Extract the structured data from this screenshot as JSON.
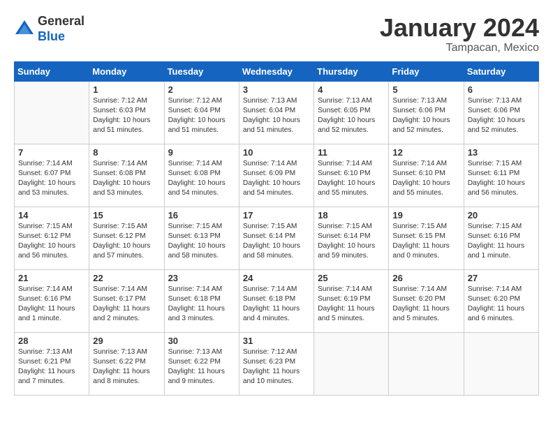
{
  "header": {
    "logo_general": "General",
    "logo_blue": "Blue",
    "month_title": "January 2024",
    "location": "Tampacan, Mexico"
  },
  "columns": [
    "Sunday",
    "Monday",
    "Tuesday",
    "Wednesday",
    "Thursday",
    "Friday",
    "Saturday"
  ],
  "weeks": [
    [
      {
        "day": "",
        "info": ""
      },
      {
        "day": "1",
        "info": "Sunrise: 7:12 AM\nSunset: 6:03 PM\nDaylight: 10 hours\nand 51 minutes."
      },
      {
        "day": "2",
        "info": "Sunrise: 7:12 AM\nSunset: 6:04 PM\nDaylight: 10 hours\nand 51 minutes."
      },
      {
        "day": "3",
        "info": "Sunrise: 7:13 AM\nSunset: 6:04 PM\nDaylight: 10 hours\nand 51 minutes."
      },
      {
        "day": "4",
        "info": "Sunrise: 7:13 AM\nSunset: 6:05 PM\nDaylight: 10 hours\nand 52 minutes."
      },
      {
        "day": "5",
        "info": "Sunrise: 7:13 AM\nSunset: 6:06 PM\nDaylight: 10 hours\nand 52 minutes."
      },
      {
        "day": "6",
        "info": "Sunrise: 7:13 AM\nSunset: 6:06 PM\nDaylight: 10 hours\nand 52 minutes."
      }
    ],
    [
      {
        "day": "7",
        "info": "Sunrise: 7:14 AM\nSunset: 6:07 PM\nDaylight: 10 hours\nand 53 minutes."
      },
      {
        "day": "8",
        "info": "Sunrise: 7:14 AM\nSunset: 6:08 PM\nDaylight: 10 hours\nand 53 minutes."
      },
      {
        "day": "9",
        "info": "Sunrise: 7:14 AM\nSunset: 6:08 PM\nDaylight: 10 hours\nand 54 minutes."
      },
      {
        "day": "10",
        "info": "Sunrise: 7:14 AM\nSunset: 6:09 PM\nDaylight: 10 hours\nand 54 minutes."
      },
      {
        "day": "11",
        "info": "Sunrise: 7:14 AM\nSunset: 6:10 PM\nDaylight: 10 hours\nand 55 minutes."
      },
      {
        "day": "12",
        "info": "Sunrise: 7:14 AM\nSunset: 6:10 PM\nDaylight: 10 hours\nand 55 minutes."
      },
      {
        "day": "13",
        "info": "Sunrise: 7:15 AM\nSunset: 6:11 PM\nDaylight: 10 hours\nand 56 minutes."
      }
    ],
    [
      {
        "day": "14",
        "info": "Sunrise: 7:15 AM\nSunset: 6:12 PM\nDaylight: 10 hours\nand 56 minutes."
      },
      {
        "day": "15",
        "info": "Sunrise: 7:15 AM\nSunset: 6:12 PM\nDaylight: 10 hours\nand 57 minutes."
      },
      {
        "day": "16",
        "info": "Sunrise: 7:15 AM\nSunset: 6:13 PM\nDaylight: 10 hours\nand 58 minutes."
      },
      {
        "day": "17",
        "info": "Sunrise: 7:15 AM\nSunset: 6:14 PM\nDaylight: 10 hours\nand 58 minutes."
      },
      {
        "day": "18",
        "info": "Sunrise: 7:15 AM\nSunset: 6:14 PM\nDaylight: 10 hours\nand 59 minutes."
      },
      {
        "day": "19",
        "info": "Sunrise: 7:15 AM\nSunset: 6:15 PM\nDaylight: 11 hours\nand 0 minutes."
      },
      {
        "day": "20",
        "info": "Sunrise: 7:15 AM\nSunset: 6:16 PM\nDaylight: 11 hours\nand 1 minute."
      }
    ],
    [
      {
        "day": "21",
        "info": "Sunrise: 7:14 AM\nSunset: 6:16 PM\nDaylight: 11 hours\nand 1 minute."
      },
      {
        "day": "22",
        "info": "Sunrise: 7:14 AM\nSunset: 6:17 PM\nDaylight: 11 hours\nand 2 minutes."
      },
      {
        "day": "23",
        "info": "Sunrise: 7:14 AM\nSunset: 6:18 PM\nDaylight: 11 hours\nand 3 minutes."
      },
      {
        "day": "24",
        "info": "Sunrise: 7:14 AM\nSunset: 6:18 PM\nDaylight: 11 hours\nand 4 minutes."
      },
      {
        "day": "25",
        "info": "Sunrise: 7:14 AM\nSunset: 6:19 PM\nDaylight: 11 hours\nand 5 minutes."
      },
      {
        "day": "26",
        "info": "Sunrise: 7:14 AM\nSunset: 6:20 PM\nDaylight: 11 hours\nand 5 minutes."
      },
      {
        "day": "27",
        "info": "Sunrise: 7:14 AM\nSunset: 6:20 PM\nDaylight: 11 hours\nand 6 minutes."
      }
    ],
    [
      {
        "day": "28",
        "info": "Sunrise: 7:13 AM\nSunset: 6:21 PM\nDaylight: 11 hours\nand 7 minutes."
      },
      {
        "day": "29",
        "info": "Sunrise: 7:13 AM\nSunset: 6:22 PM\nDaylight: 11 hours\nand 8 minutes."
      },
      {
        "day": "30",
        "info": "Sunrise: 7:13 AM\nSunset: 6:22 PM\nDaylight: 11 hours\nand 9 minutes."
      },
      {
        "day": "31",
        "info": "Sunrise: 7:12 AM\nSunset: 6:23 PM\nDaylight: 11 hours\nand 10 minutes."
      },
      {
        "day": "",
        "info": ""
      },
      {
        "day": "",
        "info": ""
      },
      {
        "day": "",
        "info": ""
      }
    ]
  ]
}
